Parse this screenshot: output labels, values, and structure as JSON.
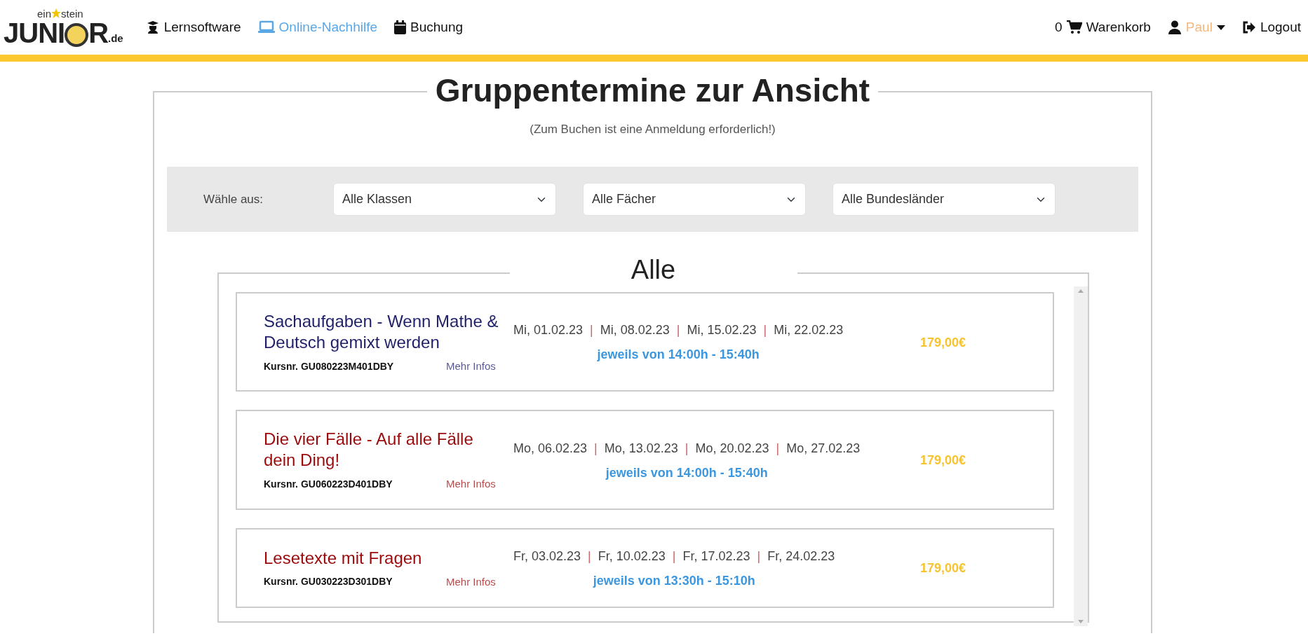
{
  "logo": {
    "top_left": "ein",
    "top_right": "stein",
    "main_left": "JUNI",
    "main_right": "R",
    "suffix": ".de"
  },
  "nav": [
    {
      "label": "Lernsoftware",
      "selected": false
    },
    {
      "label": "Online-Nachhilfe",
      "selected": true
    },
    {
      "label": "Buchung",
      "selected": false
    }
  ],
  "cart": {
    "count": "0",
    "label": "Warenkorb"
  },
  "user": {
    "name": "Paul"
  },
  "logout": {
    "label": "Logout"
  },
  "page": {
    "title": "Gruppentermine zur Ansicht",
    "subtitle": "(Zum Buchen ist eine Anmeldung erforderlich!)"
  },
  "filters": {
    "label": "Wähle aus:",
    "selects": [
      {
        "value": "Alle Klassen"
      },
      {
        "value": "Alle Fächer"
      },
      {
        "value": "Alle Bundesländer"
      }
    ]
  },
  "section": {
    "title": "Alle"
  },
  "courses": [
    {
      "title": "Sachaufgaben - Wenn Mathe & Deutsch gemixt werden",
      "color": "#1f1f6b",
      "course_no": "Kursnr. GU080223M401DBY",
      "more": "Mehr Infos",
      "dates": [
        "Mi, 01.02.23",
        "Mi, 08.02.23",
        "Mi, 15.02.23",
        "Mi, 22.02.23"
      ],
      "separator": "|",
      "time": "jeweils von 14:00h - 15:40h",
      "price": "179,00€"
    },
    {
      "title": "Die vier Fälle - Auf alle Fälle dein Ding!",
      "color": "#9b0a0a",
      "course_no": "Kursnr. GU060223D401DBY",
      "more": "Mehr Infos",
      "dates": [
        "Mo, 06.02.23",
        "Mo, 13.02.23",
        "Mo, 20.02.23",
        "Mo, 27.02.23"
      ],
      "separator": "|",
      "time": "jeweils von 14:00h - 15:40h",
      "price": "179,00€"
    },
    {
      "title": "Lesetexte mit Fragen",
      "color": "#9b0a0a",
      "course_no": "Kursnr. GU030223D301DBY",
      "more": "Mehr Infos",
      "dates": [
        "Fr, 03.02.23",
        "Fr, 10.02.23",
        "Fr, 17.02.23",
        "Fr, 24.02.23"
      ],
      "separator": "|",
      "time": "jeweils von 13:30h - 15:10h",
      "price": "179,00€"
    }
  ]
}
